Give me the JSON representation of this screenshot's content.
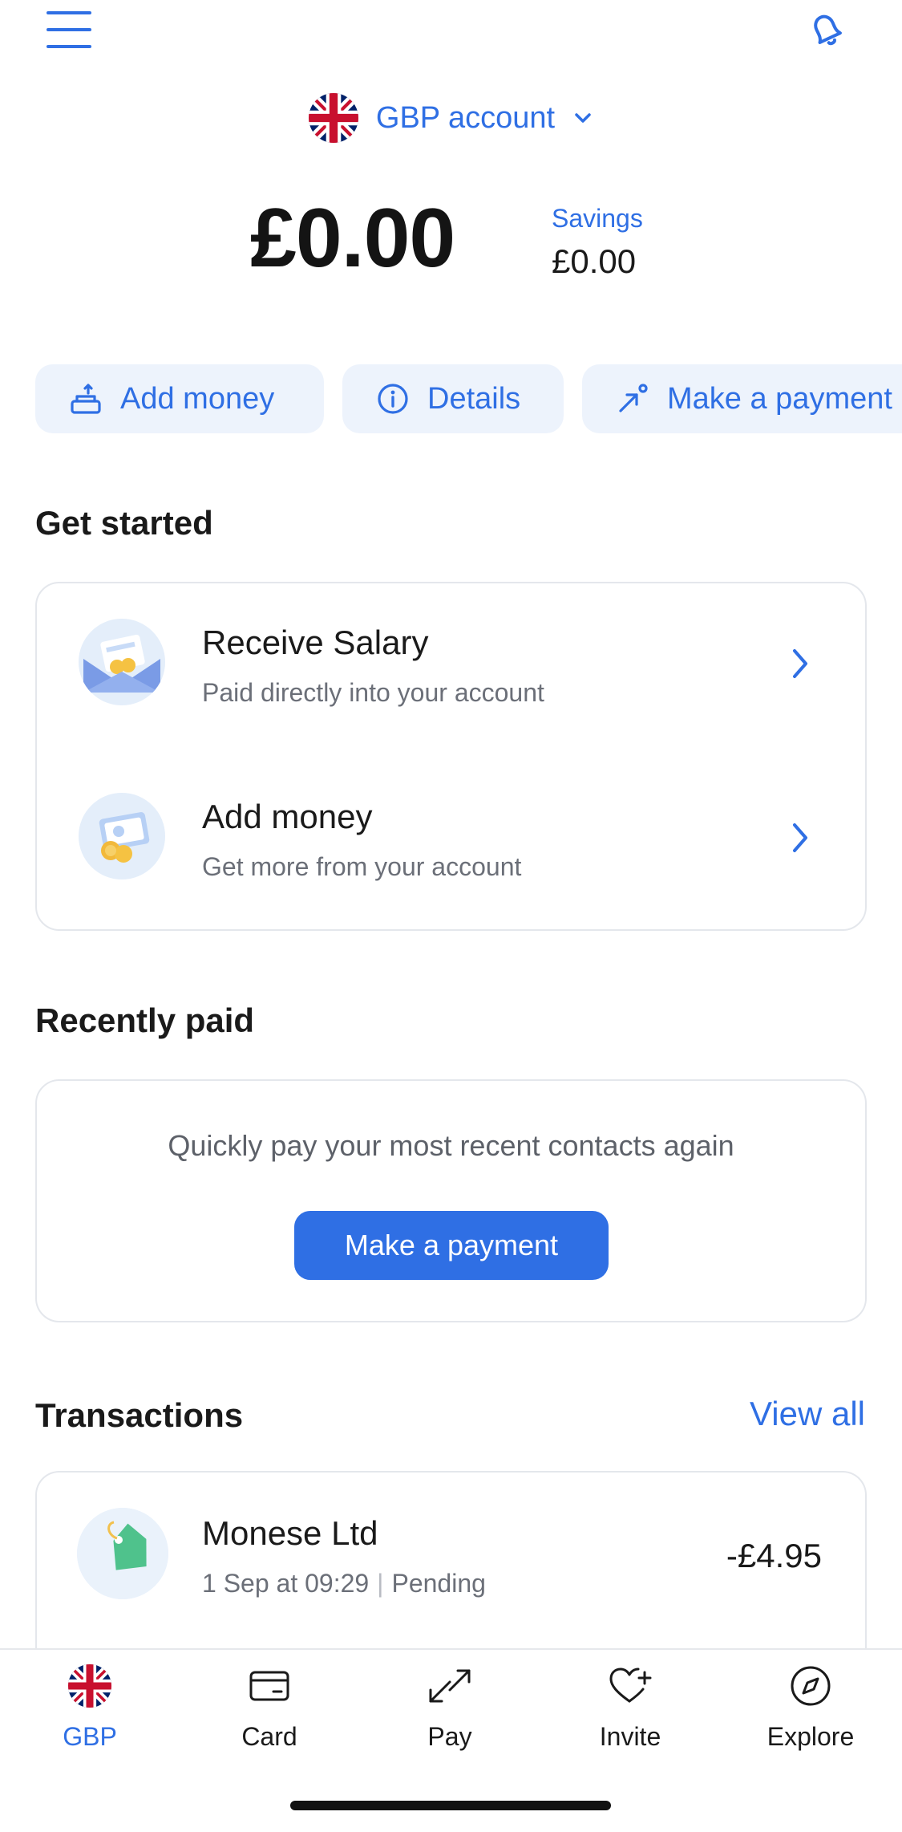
{
  "header": {
    "account_label": "GBP account",
    "balance": "£0.00",
    "savings_label": "Savings",
    "savings_value": "£0.00"
  },
  "actions": [
    {
      "label": "Add money",
      "icon": "add-money-icon"
    },
    {
      "label": "Details",
      "icon": "info-icon"
    },
    {
      "label": "Make a payment",
      "icon": "send-arrow-icon"
    }
  ],
  "get_started": {
    "title": "Get started",
    "items": [
      {
        "title": "Receive Salary",
        "subtitle": "Paid directly into your account",
        "icon": "salary-envelope-icon"
      },
      {
        "title": "Add money",
        "subtitle": "Get more from your account",
        "icon": "coins-card-icon"
      }
    ]
  },
  "recently_paid": {
    "title": "Recently paid",
    "text": "Quickly pay your most recent contacts again",
    "button": "Make a payment"
  },
  "transactions": {
    "title": "Transactions",
    "view_all": "View all",
    "items": [
      {
        "merchant": "Monese Ltd",
        "date": "1 Sep at 09:29",
        "status": "Pending",
        "amount": "-£4.95",
        "icon": "price-tag-icon"
      }
    ]
  },
  "nav": [
    {
      "label": "GBP",
      "icon": "uk-flag-icon",
      "active": true
    },
    {
      "label": "Card",
      "icon": "card-icon",
      "active": false
    },
    {
      "label": "Pay",
      "icon": "pay-arrows-icon",
      "active": false
    },
    {
      "label": "Invite",
      "icon": "heart-plus-icon",
      "active": false
    },
    {
      "label": "Explore",
      "icon": "compass-icon",
      "active": false
    }
  ],
  "colors": {
    "accent": "#2f6fe4",
    "chip_bg": "#edf3fc",
    "text": "#1a1a1a",
    "muted": "#6b6f78"
  }
}
